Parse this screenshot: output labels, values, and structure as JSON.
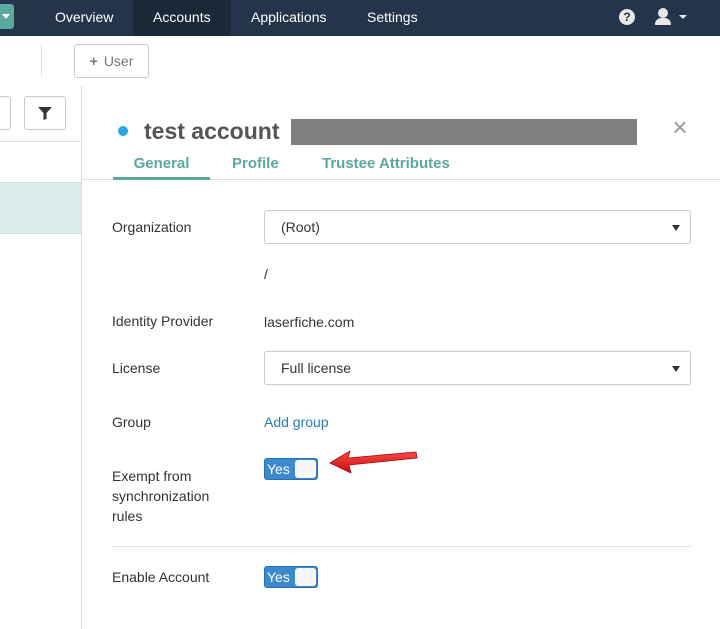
{
  "nav": {
    "items": [
      "Overview",
      "Accounts",
      "Applications",
      "Settings"
    ],
    "active": "Accounts",
    "help_label": "?"
  },
  "toolbar": {
    "add_user_label": "User"
  },
  "account": {
    "title": "test account",
    "close_label": "×",
    "tabs": [
      "General",
      "Profile",
      "Trustee Attributes"
    ],
    "active_tab": "General"
  },
  "form": {
    "organization": {
      "label": "Organization",
      "value": "(Root)",
      "path": "/"
    },
    "identity_provider": {
      "label": "Identity Provider",
      "value": "laserfiche.com"
    },
    "license": {
      "label": "License",
      "value": "Full license"
    },
    "group": {
      "label": "Group",
      "action": "Add group"
    },
    "exempt": {
      "label_lines": [
        "Exempt from",
        "synchronization",
        "rules"
      ],
      "toggle": "Yes"
    },
    "enable": {
      "label": "Enable Account",
      "toggle": "Yes"
    }
  },
  "colors": {
    "nav_bg": "#24344a",
    "accent": "#5aa8a0",
    "toggle_blue": "#3b8ad0",
    "link": "#2a7bbf",
    "status_dot": "#2aa7e0",
    "annotation_arrow": "#e01818"
  }
}
